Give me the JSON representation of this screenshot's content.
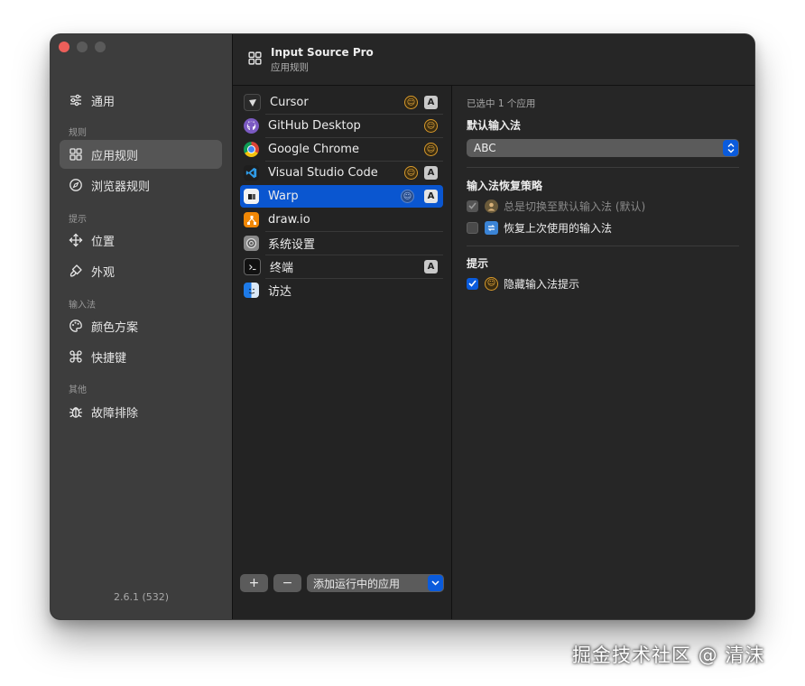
{
  "sidebar": {
    "items": [
      {
        "label": "通用",
        "icon": "sliders-icon"
      },
      {
        "section": "规则"
      },
      {
        "label": "应用规则",
        "icon": "grid-icon",
        "selected": true
      },
      {
        "label": "浏览器规则",
        "icon": "compass-icon"
      },
      {
        "section": "提示"
      },
      {
        "label": "位置",
        "icon": "move-arrows-icon"
      },
      {
        "label": "外观",
        "icon": "brush-icon"
      },
      {
        "section": "输入法"
      },
      {
        "label": "颜色方案",
        "icon": "palette-icon"
      },
      {
        "label": "快捷键",
        "icon": "command-key-icon"
      },
      {
        "section": "其他"
      },
      {
        "label": "故障排除",
        "icon": "bug-icon"
      }
    ],
    "sections": {
      "rules": "规则",
      "tips": "提示",
      "input_method": "输入法",
      "other": "其他"
    },
    "labels": {
      "general": "通用",
      "app_rules": "应用规则",
      "browser_rules": "浏览器规则",
      "position": "位置",
      "appearance": "外观",
      "color_scheme": "颜色方案",
      "shortcuts": "快捷键",
      "troubleshooting": "故障排除"
    },
    "version": "2.6.1 (532)"
  },
  "header": {
    "title": "Input Source Pro",
    "subtitle": "应用规则"
  },
  "apps": [
    {
      "name": "Cursor",
      "emoji": true,
      "a_badge": true
    },
    {
      "name": "GitHub Desktop",
      "emoji": true,
      "a_badge": false
    },
    {
      "name": "Google Chrome",
      "emoji": true,
      "a_badge": false
    },
    {
      "name": "Visual Studio Code",
      "emoji": true,
      "a_badge": true
    },
    {
      "name": "Warp",
      "emoji": true,
      "a_badge": true,
      "selected": true
    },
    {
      "name": "draw.io",
      "emoji": false,
      "a_badge": false
    },
    {
      "name": "系统设置",
      "emoji": false,
      "a_badge": false
    },
    {
      "name": "终端",
      "emoji": false,
      "a_badge": true
    },
    {
      "name": "访达",
      "emoji": false,
      "a_badge": false
    }
  ],
  "list_footer": {
    "add_label": "+",
    "remove_label": "−",
    "add_running_label": "添加运行中的应用"
  },
  "badge_letter": "A",
  "detail": {
    "selected_count": "已选中 1 个应用",
    "default_input_heading": "默认输入法",
    "default_input_value": "ABC",
    "restore_heading": "输入法恢复策略",
    "restore_options": [
      {
        "label": "总是切换至默认输入法 (默认)",
        "checked": true,
        "disabled": true
      },
      {
        "label": "恢复上次使用的输入法",
        "checked": false,
        "disabled": false
      }
    ],
    "tips_heading": "提示",
    "tips_options": [
      {
        "label": "隐藏输入法提示",
        "checked": true,
        "disabled": false
      }
    ]
  },
  "watermark": "掘金技术社区 @ 清沫",
  "colors": {
    "accent": "#0a5bdc",
    "selected_row": "#0a56d0",
    "close_button": "#ec5f5a"
  }
}
